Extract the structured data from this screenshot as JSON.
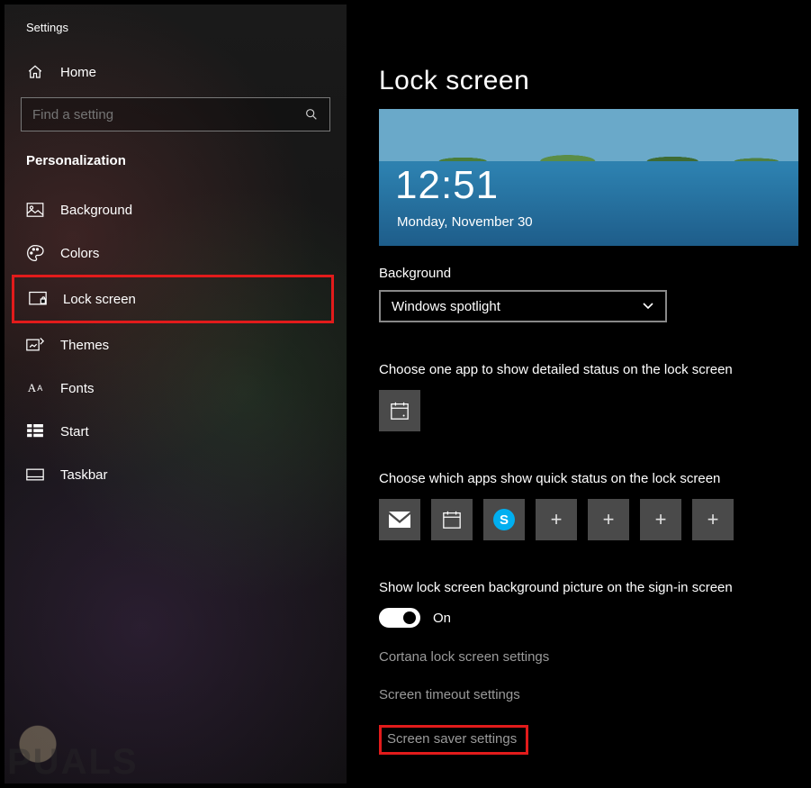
{
  "app_title": "Settings",
  "home_label": "Home",
  "search": {
    "placeholder": "Find a setting"
  },
  "category_label": "Personalization",
  "sidebar": {
    "items": [
      {
        "label": "Background"
      },
      {
        "label": "Colors"
      },
      {
        "label": "Lock screen"
      },
      {
        "label": "Themes"
      },
      {
        "label": "Fonts"
      },
      {
        "label": "Start"
      },
      {
        "label": "Taskbar"
      }
    ]
  },
  "page_title": "Lock screen",
  "preview": {
    "time": "12:51",
    "date": "Monday, November 30"
  },
  "background": {
    "label": "Background",
    "value": "Windows spotlight"
  },
  "detailed_status_label": "Choose one app to show detailed status on the lock screen",
  "quick_status_label": "Choose which apps show quick status on the lock screen",
  "signin_toggle": {
    "label": "Show lock screen background picture on the sign-in screen",
    "state": "On"
  },
  "links": {
    "cortana": "Cortana lock screen settings",
    "timeout": "Screen timeout settings",
    "screensaver": "Screen saver settings"
  },
  "watermark": "PUALS"
}
